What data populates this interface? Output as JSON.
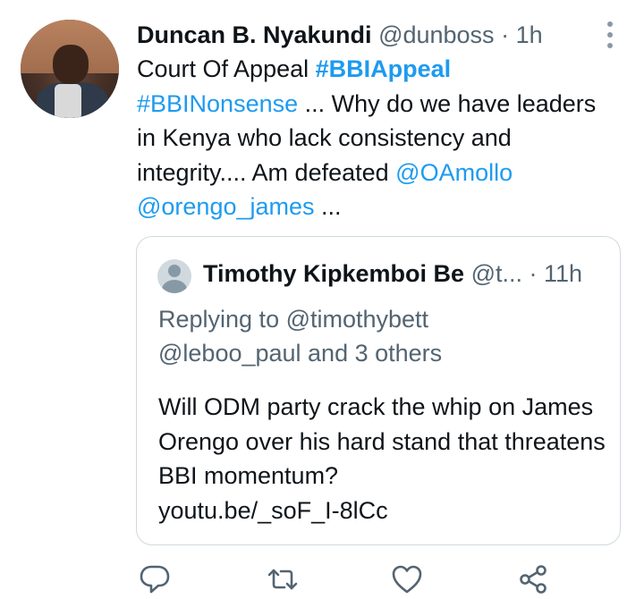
{
  "tweet": {
    "author_name": "Duncan B. Nyakundi",
    "author_handle": "@dunboss",
    "separator": "·",
    "time": "1h",
    "text_parts": {
      "p1": "Court Of Appeal ",
      "tag1": "#BBIAppeal",
      "tag2": "#BBINonsense",
      "p2": " ... Why do we have leaders in Kenya who lack consistency and integrity.... Am defeated ",
      "mention1": "@OAmollo",
      "mention2": "@orengo_james",
      "p3": " ..."
    }
  },
  "quoted_tweet": {
    "author_name": "Timothy Kipkemboi Be",
    "author_handle": "@t...",
    "separator": "·",
    "time": "11h",
    "replying_prefix": "Replying to ",
    "replying_handle": "@timothybett",
    "replying_rest": "@leboo_paul and 3 others",
    "text": "Will ODM party crack the whip on James Orengo over his hard stand that threatens BBI momentum?",
    "link": "youtu.be/_soF_I-8lCc"
  },
  "actions": [
    "reply-icon",
    "retweet-icon",
    "like-icon",
    "share-icon"
  ],
  "colors": {
    "link": "#1d9bf0",
    "muted": "#536471",
    "border": "#cfd9de"
  }
}
